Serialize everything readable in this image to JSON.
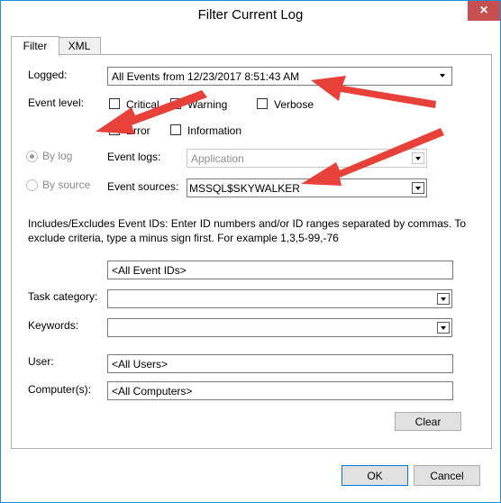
{
  "window": {
    "title": "Filter Current Log",
    "close_icon": "×"
  },
  "tabs": [
    {
      "label": "Filter"
    },
    {
      "label": "XML"
    }
  ],
  "logged": {
    "label": "Logged:",
    "value": "All Events from 12/23/2017 8:51:43 AM"
  },
  "event_level": {
    "label": "Event level:",
    "critical": {
      "label": "Critical",
      "checked": false
    },
    "warning": {
      "label": "Warning",
      "checked": false
    },
    "verbose": {
      "label": "Verbose",
      "checked": false
    },
    "error": {
      "label": "Error",
      "checked": true,
      "check_glyph": "✔"
    },
    "information": {
      "label": "Information",
      "checked": false
    }
  },
  "source_mode": {
    "by_log_label": "By log",
    "by_source_label": "By source",
    "selected": "by_log"
  },
  "event_logs": {
    "label": "Event logs:",
    "value": "Application"
  },
  "event_sources": {
    "label": "Event sources:",
    "value": "MSSQL$SKYWALKER"
  },
  "ids_help": {
    "line1": "Includes/Excludes Event IDs: Enter ID numbers and/or ID ranges separated by commas. To",
    "line2": "exclude criteria, type a minus sign first. For example 1,3,5-99,-76"
  },
  "event_ids": {
    "value": "<All Event IDs>"
  },
  "task_category": {
    "label": "Task category:",
    "value": ""
  },
  "keywords": {
    "label": "Keywords:",
    "value": ""
  },
  "user": {
    "label": "User:",
    "value": "<All Users>"
  },
  "computer": {
    "label": "Computer(s):",
    "value": "<All Computers>"
  },
  "buttons": {
    "clear": "Clear",
    "ok": "OK",
    "cancel": "Cancel"
  },
  "colors": {
    "annotation_arrow": "#e8413a",
    "window_border": "#1e8fd6",
    "close_button": "#c74f50"
  }
}
